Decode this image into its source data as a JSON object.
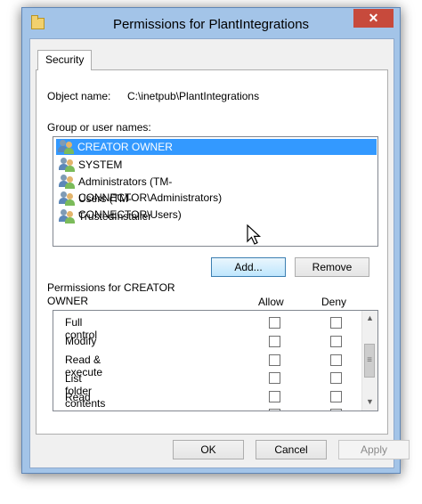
{
  "window": {
    "title": "Permissions for PlantIntegrations",
    "close_glyph": "✕"
  },
  "tab": {
    "label": "Security"
  },
  "object": {
    "label": "Object name:",
    "value": "C:\\inetpub\\PlantIntegrations"
  },
  "group": {
    "label": "Group or user names:",
    "items": [
      {
        "label": "CREATOR OWNER",
        "selected": true,
        "icon": "users-icon"
      },
      {
        "label": "SYSTEM",
        "icon": "users-icon"
      },
      {
        "label": "Administrators (TM-CONNECTOR\\Administrators)",
        "icon": "users-icon"
      },
      {
        "label": "Users (TM-CONNECTOR\\Users)",
        "icon": "users-icon"
      },
      {
        "label": "TrustedInstaller",
        "icon": "users-icon"
      }
    ]
  },
  "buttons": {
    "add": "Add...",
    "remove": "Remove",
    "ok": "OK",
    "cancel": "Cancel",
    "apply": "Apply"
  },
  "permissions": {
    "heading_line1": "Permissions for CREATOR",
    "heading_line2": "OWNER",
    "allow_header": "Allow",
    "deny_header": "Deny",
    "rows": [
      {
        "label": "Full control",
        "allow": false,
        "deny": false
      },
      {
        "label": "Modify",
        "allow": false,
        "deny": false
      },
      {
        "label": "Read & execute",
        "allow": false,
        "deny": false
      },
      {
        "label": "List folder contents",
        "allow": false,
        "deny": false
      },
      {
        "label": "Read",
        "allow": false,
        "deny": false
      }
    ]
  },
  "scrollbar": {
    "up_glyph": "▲",
    "down_glyph": "▼",
    "thumb_glyph": "≡"
  },
  "colors": {
    "selection": "#3399ff",
    "title_bar": "#a3c4e8",
    "close": "#c74a3c"
  }
}
